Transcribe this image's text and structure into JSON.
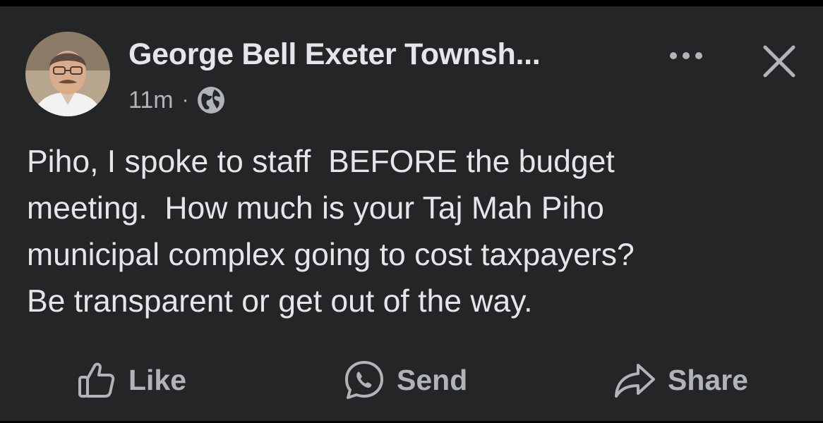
{
  "post": {
    "author": "George Bell Exeter Townsh...",
    "timestamp": "11m",
    "separator": "·",
    "privacy_icon": "globe-icon",
    "body": "Piho, I spoke to staff  BEFORE the budget\nmeeting.  How much is your Taj Mah Piho\nmunicipal complex going to cost taxpayers?\nBe transparent or get out of the way."
  },
  "header_icons": {
    "more": "more-dots-icon",
    "close": "close-icon"
  },
  "actions": [
    {
      "label": "Like",
      "icon": "thumbs-up-icon"
    },
    {
      "label": "Send",
      "icon": "messenger-icon"
    },
    {
      "label": "Share",
      "icon": "share-arrow-icon"
    }
  ],
  "colors": {
    "background": "#242526",
    "primary_text": "#e4e6eb",
    "secondary_text": "#b0b3b8"
  }
}
